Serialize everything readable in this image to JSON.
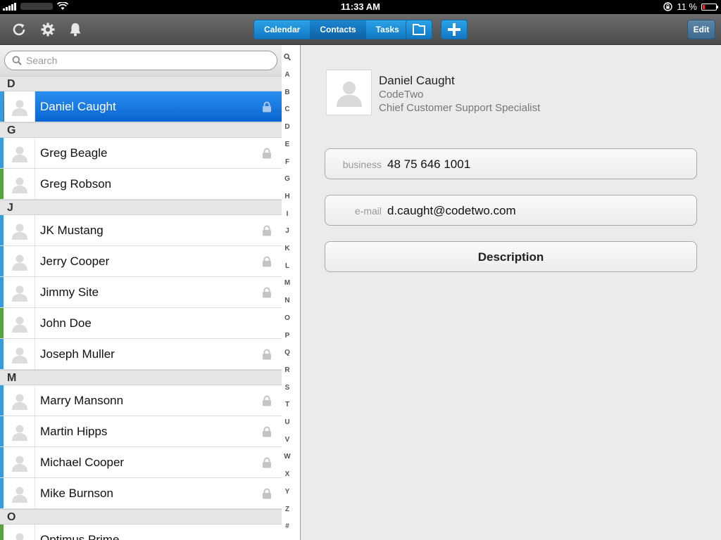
{
  "status": {
    "time": "11:33 AM",
    "battery": "11 %"
  },
  "toolbar": {
    "tabs": [
      "Calendar",
      "Contacts",
      "Tasks"
    ],
    "active_tab": "Contacts",
    "edit_label": "Edit"
  },
  "search": {
    "placeholder": "Search"
  },
  "contacts": [
    {
      "section": "D",
      "rows": [
        {
          "name": "Daniel Caught",
          "lock": true,
          "color": "#3a9ad9",
          "selected": true
        }
      ]
    },
    {
      "section": "G",
      "rows": [
        {
          "name": "Greg Beagle",
          "lock": true,
          "color": "#3a9ad9"
        },
        {
          "name": "Greg Robson",
          "lock": false,
          "color": "#5aa042"
        }
      ]
    },
    {
      "section": "J",
      "rows": [
        {
          "name": "JK Mustang",
          "lock": true,
          "color": "#3a9ad9"
        },
        {
          "name": "Jerry Cooper",
          "lock": true,
          "color": "#3a9ad9"
        },
        {
          "name": "Jimmy Site",
          "lock": true,
          "color": "#3a9ad9"
        },
        {
          "name": "John Doe",
          "lock": false,
          "color": "#5aa042"
        },
        {
          "name": "Joseph Muller",
          "lock": true,
          "color": "#3a9ad9"
        }
      ]
    },
    {
      "section": "M",
      "rows": [
        {
          "name": "Marry Mansonn",
          "lock": true,
          "color": "#3a9ad9"
        },
        {
          "name": "Martin Hipps",
          "lock": true,
          "color": "#3a9ad9"
        },
        {
          "name": "Michael Cooper",
          "lock": true,
          "color": "#3a9ad9"
        },
        {
          "name": "Mike Burnson",
          "lock": true,
          "color": "#3a9ad9"
        }
      ]
    },
    {
      "section": "O",
      "rows": [
        {
          "name": "Optimus Prime",
          "lock": false,
          "color": "#5aa042"
        }
      ]
    }
  ],
  "index_letters": [
    "A",
    "B",
    "C",
    "D",
    "E",
    "F",
    "G",
    "H",
    "I",
    "J",
    "K",
    "L",
    "M",
    "N",
    "O",
    "P",
    "Q",
    "R",
    "S",
    "T",
    "U",
    "V",
    "W",
    "X",
    "Y",
    "Z",
    "#"
  ],
  "detail": {
    "name": "Daniel Caught",
    "company": "CodeTwo",
    "title": "Chief Customer Support Specialist",
    "business_label": "business",
    "business_value": "48 75 646 1001",
    "email_label": "e-mail",
    "email_value": "d.caught@codetwo.com",
    "description_label": "Description"
  }
}
